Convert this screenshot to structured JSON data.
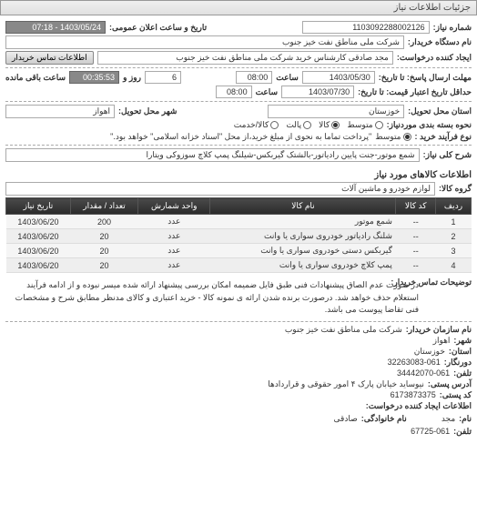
{
  "panel_title": "جزئیات اطلاعات نیاز",
  "top": {
    "req_no_label": "شماره نیاز:",
    "req_no": "1103092288002126",
    "pub_date_label": "تاریخ و ساعت اعلان عمومی:",
    "pub_date": "1403/05/24 - 07:18",
    "buyer_label": "نام دستگاه خریدار:",
    "buyer": "شرکت ملی مناطق نفت خیز جنوب",
    "creator_label": "ایجاد کننده درخواست:",
    "creator": "مجد صادقی   کارشناس خرید  شرکت ملی مناطق نفت خیز جنوب",
    "contact_btn": "اطلاعات تماس خریدار",
    "deadline_resp_label": "مهلت ارسال پاسخ: تا تاریخ:",
    "deadline_resp_date": "1403/05/30",
    "saat_label": "ساعت",
    "deadline_resp_time": "08:00",
    "days_remaining_label": "روز و",
    "days_remaining": "6",
    "time_remaining": "00:35:53",
    "time_remaining_label": "ساعت باقی مانده",
    "valid_label": "حداقل تاریخ اعتبار قیمت: تا تاریخ:",
    "valid_date": "1403/07/30",
    "valid_time": "08:00",
    "delivery_state_label": "استان محل تحویل:",
    "delivery_state": "خوزستان",
    "delivery_city_label": "شهر محل تحویل:",
    "delivery_city": "اهواز",
    "packaging_label": "نحوه بسته بندی موردنیاز:",
    "packaging_opts": [
      "متوسط",
      "کالا",
      "پالت",
      "کالا/خدمت"
    ],
    "packaging_checked": 1,
    "buy_type_label": "نوع فرآیند خرید :",
    "buy_type_opts": [
      "متوسط"
    ],
    "buy_type_note": "\"پرداخت تماما به نحوی از مبلغ خرید،از محل \"اسناد خزانه اسلامی\" خواهد بود.\"",
    "need_desc_label": "شرح کلی نیاز:",
    "need_desc": "شمع موتور-جنت پایین رادیاتور-بالشتک گیربکس-شیلنگ پمپ کلاچ سوزوکی ویتارا"
  },
  "goods": {
    "section": "اطلاعات کالاهای مورد نیاز",
    "group_label": "گروه کالا:",
    "group": "لوازم خودرو و ماشین آلات",
    "headers": [
      "ردیف",
      "کد کالا",
      "نام کالا",
      "واحد شمارش",
      "تعداد / مقدار",
      "تاریخ نیاز"
    ],
    "rows": [
      [
        "1",
        "--",
        "شمع موتور",
        "عدد",
        "200",
        "1403/06/20"
      ],
      [
        "2",
        "--",
        "شلنگ رادیاتور خودروی سواری یا وانت",
        "عدد",
        "20",
        "1403/06/20"
      ],
      [
        "3",
        "--",
        "گیربکس دستی خودروی سواری یا وانت",
        "عدد",
        "20",
        "1403/06/20"
      ],
      [
        "4",
        "--",
        "پمپ کلاچ خودروی سواری یا وانت",
        "عدد",
        "20",
        "1403/06/20"
      ]
    ]
  },
  "notes": {
    "label": "توضیحات تماس خریدار:",
    "text": "در صورت عدم الصاق پیشنهادات فنی طبق فایل ضمیمه امکان بررسی پیشنهاد ارائه شده میسر نبوده و از ادامه فرآیند استعلام حذف خواهد شد. درصورت برنده شدن ارائه ی نمونه کالا - خرید اعتباری و کالای مدنظر مطابق شرح و مشخصات فنی تقاضا پیوست می باشد."
  },
  "footer": {
    "org_label": "نام سازمان خریدار:",
    "org": "شرکت ملی مناطق نفت خیز جنوب",
    "city_label": "شهر:",
    "city": "اهواز",
    "province_label": "استان:",
    "province": "خوزستان",
    "fax_label": "دورنگار:",
    "fax": "32263083-061",
    "phone_label": "تلفن:",
    "phone": "34442070-061",
    "postal_label": "آدرس پستی:",
    "postal": "نیوساید خیابان پارک ۴ امور حقوقی و قراردادها",
    "postcode_label": "کد پستی:",
    "postcode": "6173873375",
    "creator_info_label": "اطلاعات ایجاد کننده درخواست:",
    "name_label": "نام:",
    "name": "مجد",
    "lastname_label": "نام خانوادگی:",
    "lastname": "صادقی",
    "tel_label": "تلفن:",
    "tel": "67725-061"
  }
}
